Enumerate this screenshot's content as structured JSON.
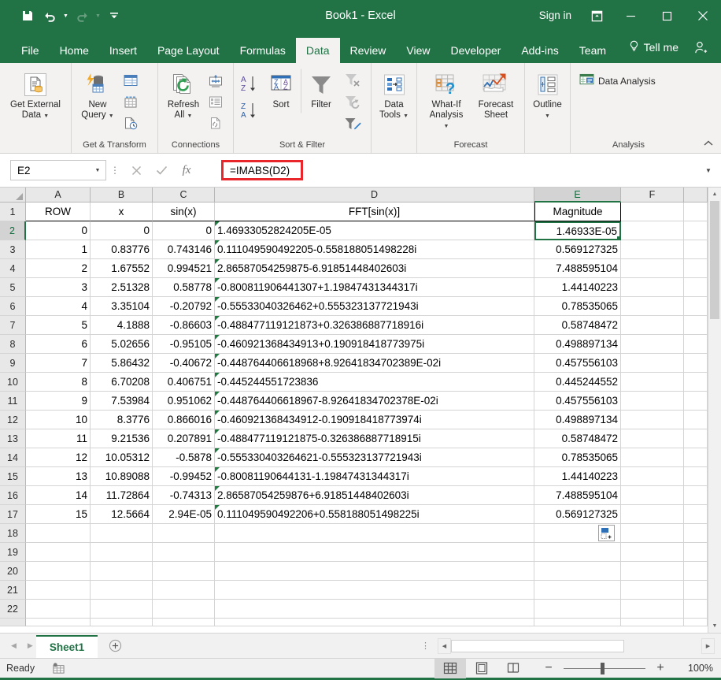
{
  "titlebar": {
    "document_title": "Book1 - Excel",
    "signin_label": "Sign in",
    "qat": [
      {
        "name": "save-icon",
        "label": "Save"
      },
      {
        "name": "undo-icon",
        "label": "Undo"
      },
      {
        "name": "redo-icon",
        "label": "Redo"
      },
      {
        "name": "customize-qat-icon",
        "label": "Customize Quick Access Toolbar"
      }
    ],
    "window_controls": [
      {
        "name": "ribbon-display-options-icon",
        "label": "Ribbon Display Options"
      },
      {
        "name": "minimize-icon",
        "label": "Minimize"
      },
      {
        "name": "maximize-icon",
        "label": "Maximize"
      },
      {
        "name": "close-icon",
        "label": "Close"
      }
    ]
  },
  "tabs": {
    "items": [
      {
        "label": "File",
        "active": false
      },
      {
        "label": "Home",
        "active": false
      },
      {
        "label": "Insert",
        "active": false
      },
      {
        "label": "Page Layout",
        "active": false
      },
      {
        "label": "Formulas",
        "active": false
      },
      {
        "label": "Data",
        "active": true
      },
      {
        "label": "Review",
        "active": false
      },
      {
        "label": "View",
        "active": false
      },
      {
        "label": "Developer",
        "active": false
      },
      {
        "label": "Add-ins",
        "active": false
      },
      {
        "label": "Team",
        "active": false
      }
    ],
    "tell_me": "Tell me",
    "account_icon": "account-icon"
  },
  "ribbon": {
    "groups": [
      {
        "label": "",
        "buttons": [
          {
            "label": "Get External\nData",
            "has_caret": true,
            "name": "get-external-data-button"
          }
        ]
      },
      {
        "label": "Get & Transform",
        "buttons": [
          {
            "label": "New\nQuery",
            "has_caret": true,
            "name": "new-query-button"
          }
        ],
        "small": [
          {
            "name": "show-queries-icon",
            "label": "Show Queries"
          },
          {
            "name": "from-table-icon",
            "label": "From Table"
          },
          {
            "name": "recent-sources-icon",
            "label": "Recent Sources"
          }
        ]
      },
      {
        "label": "Connections",
        "buttons": [
          {
            "label": "Refresh\nAll",
            "has_caret": true,
            "name": "refresh-all-button"
          }
        ],
        "small": [
          {
            "name": "connections-icon",
            "label": "Connections"
          },
          {
            "name": "properties-icon",
            "label": "Properties"
          },
          {
            "name": "edit-links-icon",
            "label": "Edit Links"
          }
        ]
      },
      {
        "label": "Sort & Filter",
        "buttons": [
          {
            "label": "Sort",
            "has_caret": false,
            "name": "sort-button"
          },
          {
            "label": "Filter",
            "has_caret": false,
            "name": "filter-button"
          }
        ],
        "small": [
          {
            "name": "sort-ascending-icon",
            "label": "Sort A to Z"
          },
          {
            "name": "sort-descending-icon",
            "label": "Sort Z to A"
          },
          {
            "name": "clear-filter-icon",
            "label": "Clear"
          },
          {
            "name": "reapply-filter-icon",
            "label": "Reapply"
          },
          {
            "name": "advanced-filter-icon",
            "label": "Advanced"
          }
        ]
      },
      {
        "label": "",
        "buttons": [
          {
            "label": "Data\nTools",
            "has_caret": true,
            "name": "data-tools-button"
          }
        ]
      },
      {
        "label": "Forecast",
        "buttons": [
          {
            "label": "What-If\nAnalysis",
            "has_caret": true,
            "name": "what-if-analysis-button"
          },
          {
            "label": "Forecast\nSheet",
            "has_caret": false,
            "name": "forecast-sheet-button"
          }
        ]
      },
      {
        "label": "",
        "buttons": [
          {
            "label": "Outline",
            "has_caret": true,
            "name": "outline-button"
          }
        ]
      },
      {
        "label": "Analysis",
        "buttons": [],
        "wide": [
          {
            "label": "Data Analysis",
            "name": "data-analysis-button"
          }
        ]
      }
    ],
    "collapse_icon": "collapse-ribbon-icon"
  },
  "formula_bar": {
    "name_box_value": "E2",
    "cancel_icon": "cancel-icon",
    "enter_icon": "enter-icon",
    "function_icon": "insert-function-icon",
    "formula_value": "=IMABS(D2)",
    "expand_icon": "expand-formula-bar-icon",
    "highlight_color": "#e8262b"
  },
  "grid": {
    "columns": [
      "A",
      "B",
      "C",
      "D",
      "E",
      "F"
    ],
    "selected_column": "E",
    "selected_row": 2,
    "selected_cell": "E2",
    "row_numbers": [
      1,
      2,
      3,
      4,
      5,
      6,
      7,
      8,
      9,
      10,
      11,
      12,
      13,
      14,
      15,
      16,
      17,
      18,
      19,
      20,
      21,
      22
    ],
    "headers": {
      "A": "ROW",
      "B": "x",
      "C": "sin(x)",
      "D": "FFT[sin(x)]",
      "E": "Magnitude",
      "F": ""
    },
    "rows": [
      {
        "row": 2,
        "A": "0",
        "B": "0",
        "C": "0",
        "D": "1.46933052824205E-05",
        "E": "1.46933E-05",
        "d_flag": true
      },
      {
        "row": 3,
        "A": "1",
        "B": "0.83776",
        "C": "0.743146",
        "D": "0.111049590492205-0.558188051498228i",
        "E": "0.569127325",
        "d_flag": true
      },
      {
        "row": 4,
        "A": "2",
        "B": "1.67552",
        "C": "0.994521",
        "D": "2.86587054259875-6.91851448402603i",
        "E": "7.488595104",
        "d_flag": true
      },
      {
        "row": 5,
        "A": "3",
        "B": "2.51328",
        "C": "0.58778",
        "D": "-0.800811906441307+1.19847431344317i",
        "E": "1.44140223",
        "d_flag": true
      },
      {
        "row": 6,
        "A": "4",
        "B": "3.35104",
        "C": "-0.20792",
        "D": "-0.55533040326462+0.555323137721943i",
        "E": "0.78535065",
        "d_flag": true
      },
      {
        "row": 7,
        "A": "5",
        "B": "4.1888",
        "C": "-0.86603",
        "D": "-0.488477119121873+0.326386887718916i",
        "E": "0.58748472",
        "d_flag": true
      },
      {
        "row": 8,
        "A": "6",
        "B": "5.02656",
        "C": "-0.95105",
        "D": "-0.460921368434913+0.190918418773975i",
        "E": "0.498897134",
        "d_flag": true
      },
      {
        "row": 9,
        "A": "7",
        "B": "5.86432",
        "C": "-0.40672",
        "D": "-0.448764406618968+8.92641834702389E-02i",
        "E": "0.457556103",
        "d_flag": true
      },
      {
        "row": 10,
        "A": "8",
        "B": "6.70208",
        "C": "0.406751",
        "D": "-0.445244551723836",
        "E": "0.445244552",
        "d_flag": true
      },
      {
        "row": 11,
        "A": "9",
        "B": "7.53984",
        "C": "0.951062",
        "D": "-0.448764406618967-8.92641834702378E-02i",
        "E": "0.457556103",
        "d_flag": true
      },
      {
        "row": 12,
        "A": "10",
        "B": "8.3776",
        "C": "0.866016",
        "D": "-0.460921368434912-0.190918418773974i",
        "E": "0.498897134",
        "d_flag": true
      },
      {
        "row": 13,
        "A": "11",
        "B": "9.21536",
        "C": "0.207891",
        "D": "-0.488477119121875-0.326386887718915i",
        "E": "0.58748472",
        "d_flag": true
      },
      {
        "row": 14,
        "A": "12",
        "B": "10.05312",
        "C": "-0.5878",
        "D": "-0.555330403264621-0.555323137721943i",
        "E": "0.78535065",
        "d_flag": true
      },
      {
        "row": 15,
        "A": "13",
        "B": "10.89088",
        "C": "-0.99452",
        "D": "-0.80081190644131-1.19847431344317i",
        "E": "1.44140223",
        "d_flag": true
      },
      {
        "row": 16,
        "A": "14",
        "B": "11.72864",
        "C": "-0.74313",
        "D": "2.86587054259876+6.91851448402603i",
        "E": "7.488595104",
        "d_flag": true
      },
      {
        "row": 17,
        "A": "15",
        "B": "12.5664",
        "C": "2.94E-05",
        "D": "0.111049590492206+0.558188051498225i",
        "E": "0.569127325",
        "d_flag": true
      }
    ],
    "fill_options_icon": "auto-fill-options-icon"
  },
  "sheet_bar": {
    "prev_icon": "previous-sheet-icon",
    "next_icon": "next-sheet-icon",
    "sheets": [
      {
        "name": "Sheet1",
        "active": true
      }
    ],
    "add_sheet_icon": "add-sheet-icon"
  },
  "status_bar": {
    "status_text": "Ready",
    "macro_icon": "record-macro-icon",
    "views": [
      {
        "name": "normal-view-button",
        "active": true
      },
      {
        "name": "page-layout-view-button",
        "active": false
      },
      {
        "name": "page-break-preview-button",
        "active": false
      }
    ],
    "zoom_out_label": "−",
    "zoom_in_label": "+",
    "zoom_level": "100%"
  },
  "colors": {
    "excel_green": "#217346",
    "ribbon_bg": "#f3f2f1",
    "selection": "#217346",
    "highlight_red": "#e8262b"
  }
}
